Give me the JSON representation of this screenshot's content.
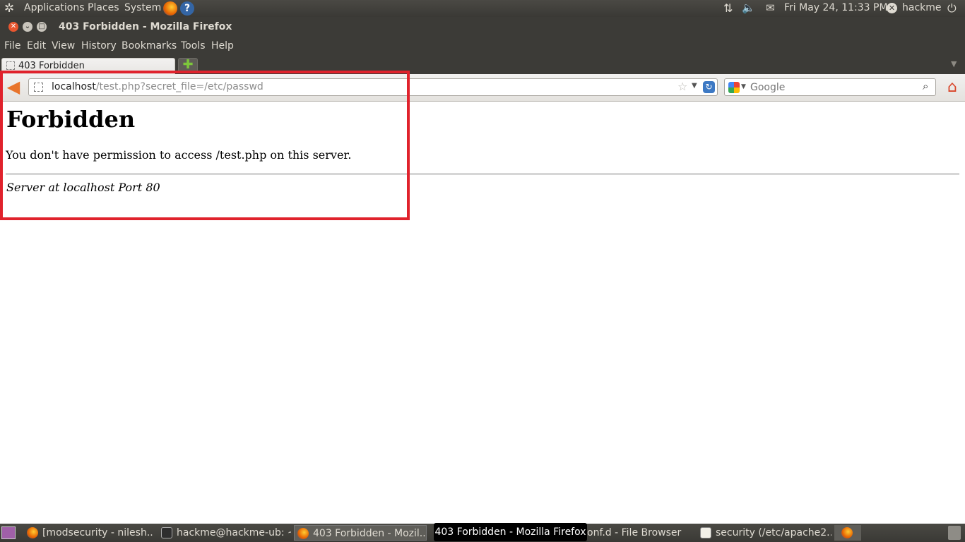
{
  "top_panel": {
    "applications": "Applications",
    "places": "Places",
    "system": "System",
    "datetime": "Fri May 24, 11:33 PM",
    "user": "hackme"
  },
  "window": {
    "title": "403 Forbidden - Mozilla Firefox"
  },
  "menubar": {
    "items": [
      "File",
      "Edit",
      "View",
      "History",
      "Bookmarks",
      "Tools",
      "Help"
    ]
  },
  "tabs": [
    {
      "label": "403 Forbidden",
      "active": true
    }
  ],
  "urlbar": {
    "host": "localhost",
    "path": "/test.php?secret_file=/etc/passwd"
  },
  "search": {
    "engine": "Google",
    "placeholder": "Google"
  },
  "page": {
    "heading": "Forbidden",
    "message": "You don't have permission to access /test.php on this server.",
    "address": "Server at localhost Port 80"
  },
  "taskbar": {
    "tasks": [
      {
        "label": "[modsecurity - nilesh...",
        "icon": "firefox-icon"
      },
      {
        "label": "hackme@hackme-ub: ~",
        "icon": "terminal-icon"
      },
      {
        "label": "403 Forbidden - Mozil...",
        "icon": "firefox-icon",
        "active": true
      },
      {
        "label": "onf.d - File Browser",
        "icon": "folder-icon"
      },
      {
        "label": "security (/etc/apache2...",
        "icon": "text-editor-icon"
      }
    ],
    "tooltip": "403 Forbidden - Mozilla Firefox"
  },
  "colors": {
    "highlight": "#e0222c",
    "panel": "#3c3b37",
    "close_button": "#e9562f"
  }
}
